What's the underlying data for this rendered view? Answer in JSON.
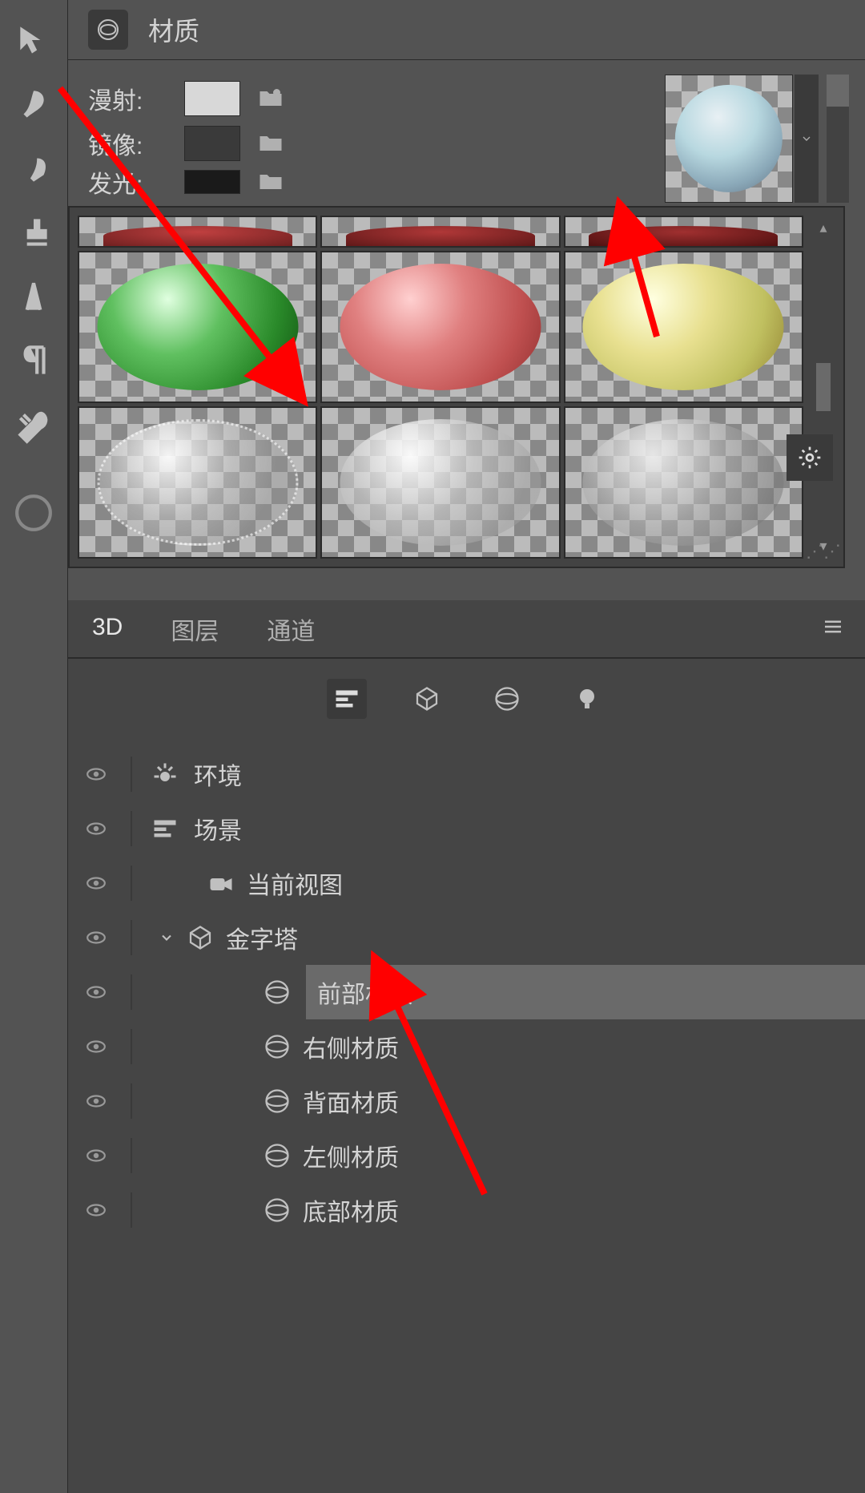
{
  "material_panel": {
    "title": "材质",
    "props": {
      "diffuse_label": "漫射:",
      "mirror_label": "镜像:",
      "glow_label": "发光:"
    },
    "diffuse_color": "#d8d8d8",
    "mirror_color": "#3a3a3a",
    "glow_color": "#1a1a1a"
  },
  "tabs": {
    "tab1": "3D",
    "tab2": "图层",
    "tab3": "通道"
  },
  "tree": {
    "environment": "环境",
    "scene": "场景",
    "current_view": "当前视图",
    "pyramid": "金字塔",
    "front_material": "前部材质",
    "right_material": "右侧材质",
    "back_material": "背面材质",
    "left_material": "左侧材质",
    "bottom_material": "底部材质"
  }
}
